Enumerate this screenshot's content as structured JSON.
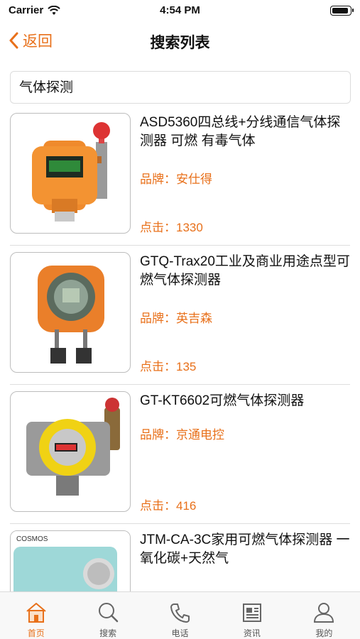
{
  "status_bar": {
    "carrier": "Carrier",
    "time": "4:54 PM"
  },
  "nav": {
    "back_label": "返回",
    "title": "搜索列表"
  },
  "search": {
    "value": "气体探测"
  },
  "products": [
    {
      "title": "ASD5360四总线+分线通信气体探测器 可燃 有毒气体",
      "brand": "品牌：安仕得",
      "clicks": "点击：1330"
    },
    {
      "title": "GTQ-Trax20工业及商业用途点型可燃气体探测器",
      "brand": "品牌：英吉森",
      "clicks": "点击：135"
    },
    {
      "title": "GT-KT6602可燃气体探测器",
      "brand": "品牌：京通电控",
      "clicks": "点击：416"
    },
    {
      "title": "JTM-CA-3C家用可燃气体探测器 一氧化碳+天然气",
      "thumb_text": "COSMOS"
    }
  ],
  "tabs": [
    {
      "label": "首页",
      "icon": "home-icon"
    },
    {
      "label": "搜索",
      "icon": "search-icon"
    },
    {
      "label": "电话",
      "icon": "phone-icon"
    },
    {
      "label": "资讯",
      "icon": "news-icon"
    },
    {
      "label": "我的",
      "icon": "profile-icon"
    }
  ],
  "colors": {
    "accent": "#e8701a",
    "separator": "#dedede"
  }
}
